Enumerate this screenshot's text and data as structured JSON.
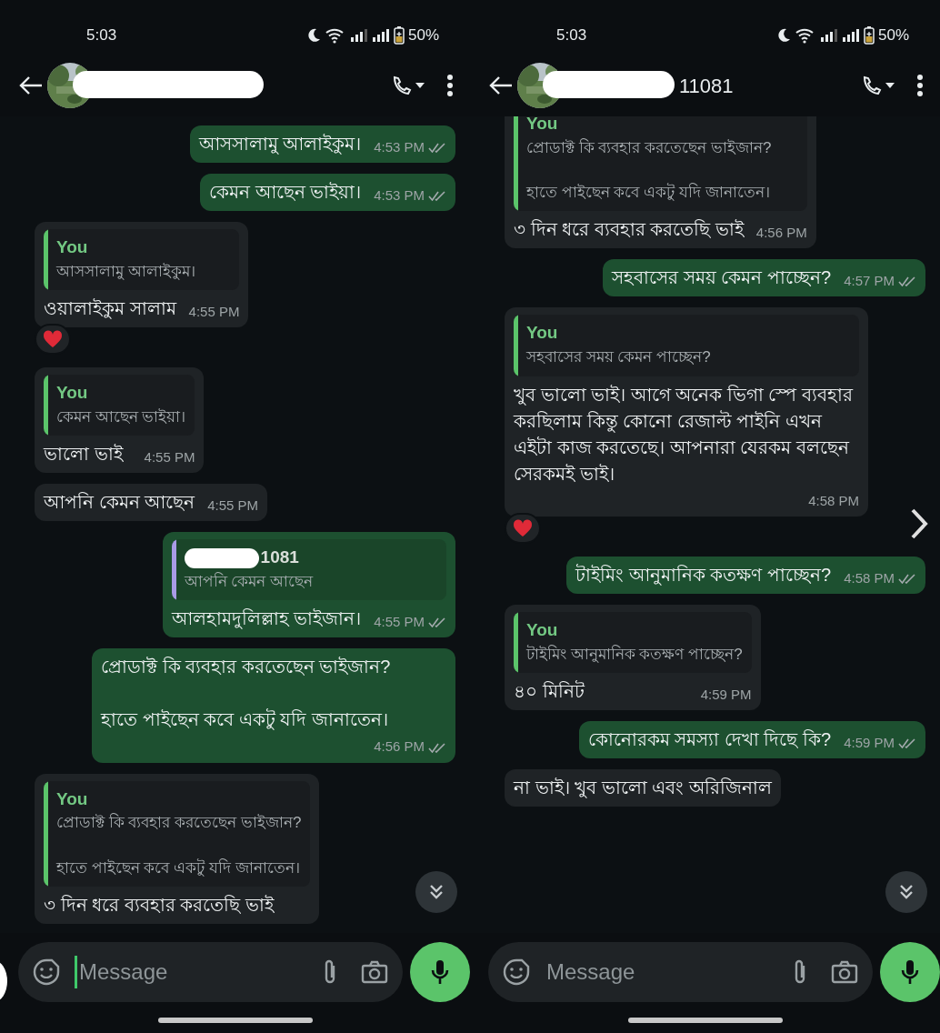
{
  "panels": [
    {
      "status_bar": {
        "time": "5:03",
        "battery": "50%"
      },
      "header": {
        "redacted": true
      },
      "messages": [
        {
          "kind": "outgoing",
          "text": "আসসালামু আলাইকুম।",
          "time": "4:53 PM",
          "read": true
        },
        {
          "kind": "outgoing",
          "text": "কেমন আছেন ভাইয়া।",
          "time": "4:53 PM",
          "read": true
        },
        {
          "kind": "incoming",
          "quote": {
            "author": "You",
            "text": "আসসালামু আলাইকুম।",
            "color": "#5bc46a"
          },
          "text": "ওয়ালাইকুম সালাম",
          "time": "4:55 PM",
          "reacted": true
        },
        {
          "kind": "incoming",
          "quote": {
            "author": "You",
            "text": "কেমন আছেন ভাইয়া।",
            "color": "#5bc46a"
          },
          "text": "ভালো ভাই",
          "time": "4:55 PM"
        },
        {
          "kind": "incoming",
          "text": "আপনি কেমন আছেন",
          "time": "4:55 PM"
        },
        {
          "kind": "outgoing",
          "quote": {
            "author": "1081",
            "redacted": true,
            "text": "আপনি কেমন আছেন",
            "color": "#a99be6"
          },
          "text": "আলহামদুলিল্লাহ ভাইজান।",
          "time": "4:55 PM",
          "read": true
        },
        {
          "kind": "outgoing",
          "text": "প্রোডাক্ট কি ব্যবহার করতেছেন ভাইজান?\n\nহাতে পাইছেন কবে একটু যদি জানাতেন।",
          "time": "4:56 PM",
          "read": true
        },
        {
          "kind": "incoming",
          "quote": {
            "author": "You",
            "text": "প্রোডাক্ট কি ব্যবহার করতেছেন ভাইজান?\n\nহাতে পাইছেন কবে একটু যদি জানাতেন।",
            "color": "#5bc46a"
          },
          "text": "৩ দিন ধরে ব্যবহার করতেছি ভাই"
        }
      ],
      "scroll_down_button": true,
      "composer": {
        "placeholder": "Message",
        "focused": true
      }
    },
    {
      "status_bar": {
        "time": "5:03",
        "battery": "50%"
      },
      "header": {
        "title": "11081",
        "redacted": true
      },
      "messages": [
        {
          "kind": "incoming",
          "quote": {
            "author": "You",
            "text": "প্রোডাক্ট কি ব্যবহার করতেছেন ভাইজান?\n\nহাতে পাইছেন কবে একটু যদি জানাতেন।",
            "color": "#5bc46a"
          },
          "text": "৩ দিন ধরে ব্যবহার করতেছি ভাই",
          "time": "4:56 PM"
        },
        {
          "kind": "outgoing",
          "text": "সহবাসের সময় কেমন পাচ্ছেন?",
          "time": "4:57 PM",
          "read": true
        },
        {
          "kind": "incoming",
          "quote": {
            "author": "You",
            "text": "সহবাসের সময় কেমন পাচ্ছেন?",
            "color": "#5bc46a"
          },
          "text": "খুব ভালো ভাই। আগে অনেক ভিগা স্পে ব্যবহার করছিলাম কিন্তু কোনো রেজাল্ট পাইনি এখন এইটা কাজ করতেছে। আপনারা যেরকম বলছেন সেরকমই ভাই।",
          "time": "4:58 PM",
          "reacted": true
        },
        {
          "kind": "outgoing",
          "text": "টাইমিং আনুমানিক কতক্ষণ পাচ্ছেন?",
          "time": "4:58 PM",
          "read": true
        },
        {
          "kind": "incoming",
          "quote": {
            "author": "You",
            "text": "টাইমিং আনুমানিক কতক্ষণ পাচ্ছেন?",
            "color": "#5bc46a"
          },
          "text": "৪০ মিনিট",
          "time": "4:59 PM"
        },
        {
          "kind": "outgoing",
          "text": "কোনোরকম সমস্যা দেখা দিছে কি?",
          "time": "4:59 PM",
          "read": true
        },
        {
          "kind": "incoming",
          "text": "না ভাই। খুব ভালো এবং অরিজিনাল"
        }
      ],
      "scroll_down_button": true,
      "next_arrow": true,
      "composer": {
        "placeholder": "Message",
        "focused": false
      }
    }
  ]
}
